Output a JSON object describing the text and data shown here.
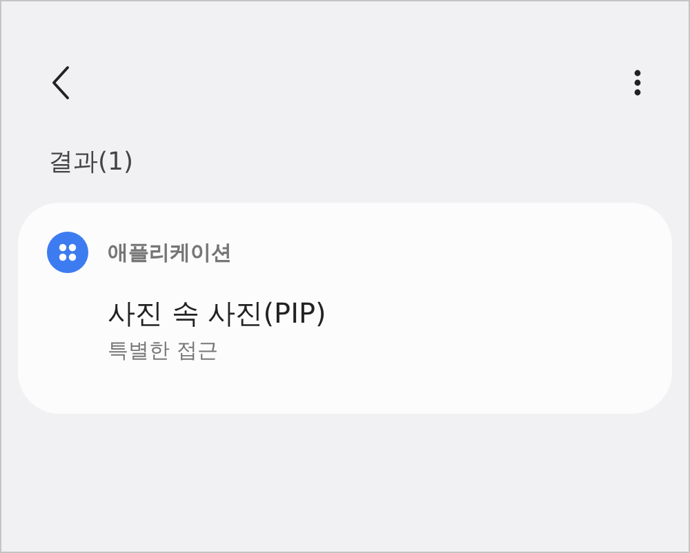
{
  "section_title": "결과(1)",
  "results": [
    {
      "category": "애플리케이션",
      "items": [
        {
          "title": "사진 속 사진(PIP)",
          "subtitle": "특별한 접근"
        }
      ]
    }
  ]
}
